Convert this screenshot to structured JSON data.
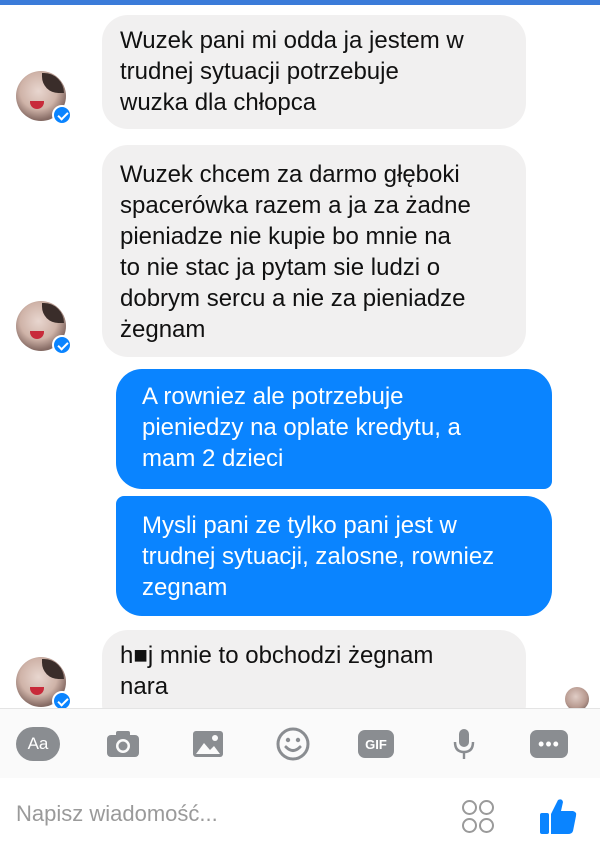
{
  "messages": [
    {
      "direction": "incoming",
      "text": "Wuzek pani mi odda ja jestem w\ntrudnej sytuacji potrzebuje\nwuzka dla chłopca"
    },
    {
      "direction": "incoming",
      "text": "Wuzek chcem za darmo głęboki\nspacerówka razem a ja za żadne\npieniadze nie kupie bo mnie na\nto nie stac ja pytam sie ludzi o\ndobrym sercu a nie za pieniadze\nżegnam"
    },
    {
      "direction": "outgoing",
      "text": "A rowniez ale potrzebuje\npieniedzy na oplate kredytu, a\nmam 2 dzieci"
    },
    {
      "direction": "outgoing",
      "text": "Mysli pani ze tylko pani jest w\ntrudnej sytuacji, zalosne, rowniez\nzegnam"
    },
    {
      "direction": "incoming",
      "text": "h■j mnie to obchodzi żegnam\nnara"
    }
  ],
  "toolbar": {
    "aa_label": "Aa",
    "gif_label": "GIF",
    "more_label": "•••",
    "icons": [
      "text-format-icon",
      "camera-icon",
      "gallery-icon",
      "emoji-icon",
      "gif-icon",
      "microphone-icon",
      "more-icon"
    ]
  },
  "composer": {
    "placeholder": "Napisz wiadomość..."
  },
  "colors": {
    "outgoing_bubble": "#0a84ff",
    "incoming_bubble": "#f1f0f0",
    "icon_gray": "#8a8d91",
    "like_blue": "#0a84ff"
  }
}
